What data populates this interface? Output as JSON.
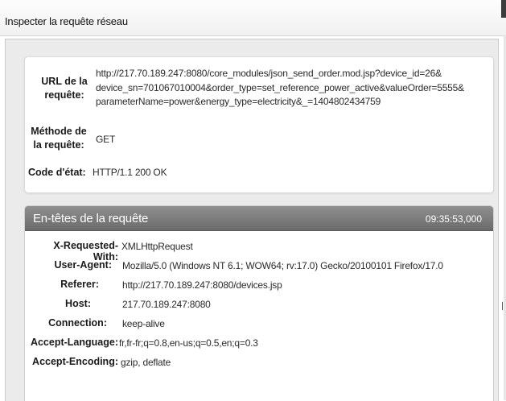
{
  "window": {
    "title": "Inspecter la requête réseau"
  },
  "request_info": {
    "url_label": "URL de la requête:",
    "url_lines": [
      "http://217.70.189.247:8080/core_modules/json_send_order.mod.jsp?device_id=26&",
      "device_sn=701067010004&order_type=set_reference_power_active&valueOrder=5555&",
      "parameterName=power&energy_type=electricity&_=1404802434759"
    ],
    "method_label": "Méthode de la requête:",
    "method_value": "GET",
    "status_label": "Code d'état:",
    "status_value": "HTTP/1.1 200 OK"
  },
  "request_headers": {
    "title": "En-têtes de la requête",
    "time": "09:35:53,000",
    "rows": [
      {
        "name": "X-Requested-With:",
        "value": "XMLHttpRequest"
      },
      {
        "name": "User-Agent:",
        "value": "Mozilla/5.0 (Windows NT 6.1; WOW64; rv:17.0) Gecko/20100101 Firefox/17.0"
      },
      {
        "name": "Referer:",
        "value": "http://217.70.189.247:8080/devices.jsp"
      },
      {
        "name": "Host:",
        "value": "217.70.189.247:8080"
      },
      {
        "name": "Connection:",
        "value": "keep-alive"
      },
      {
        "name": "Accept-Language:",
        "value": "fr,fr-fr;q=0.8,en-us;q=0.5,en;q=0.3"
      },
      {
        "name": "Accept-Encoding:",
        "value": "gzip, deflate"
      }
    ]
  }
}
